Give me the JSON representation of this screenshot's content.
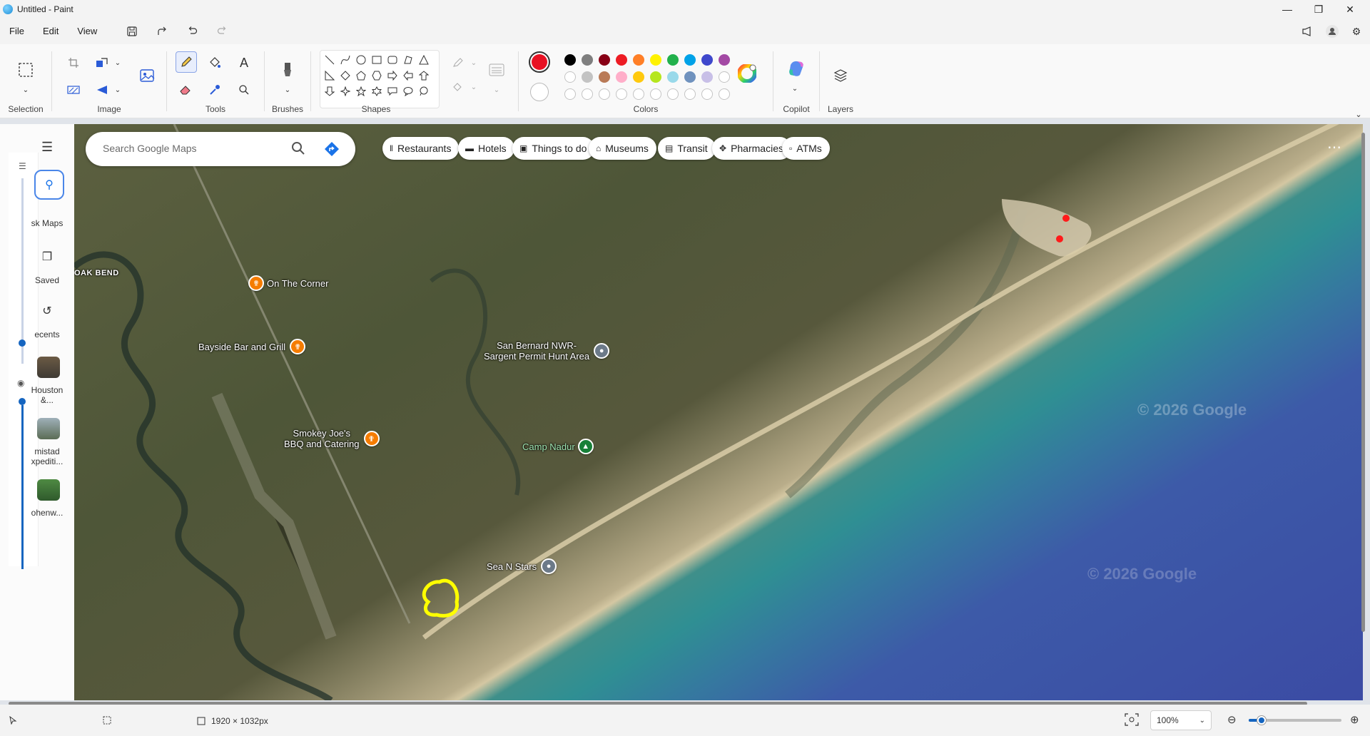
{
  "window": {
    "title": "Untitled - Paint"
  },
  "menu": {
    "file": "File",
    "edit": "Edit",
    "view": "View"
  },
  "ribbon": {
    "groups": {
      "selection": "Selection",
      "image": "Image",
      "tools": "Tools",
      "brushes": "Brushes",
      "shapes": "Shapes",
      "colors": "Colors",
      "copilot": "Copilot",
      "layers": "Layers"
    },
    "active_color": "#e81123",
    "palette_row1": [
      "#000000",
      "#7f7f7f",
      "#880015",
      "#ed1c24",
      "#ff7f27",
      "#fff200",
      "#22b14c",
      "#00a2e8",
      "#3f48cc",
      "#a349a4"
    ],
    "palette_row2": [
      "",
      "#c3c3c3",
      "#b97a57",
      "#ffaec9",
      "#ffc90e",
      "#b5e61d",
      "#99d9ea",
      "#7092be",
      "#c8bfe7"
    ]
  },
  "map": {
    "search_placeholder": "Search Google Maps",
    "chips": [
      {
        "label": "Restaurants",
        "icon": "fork-knife-icon"
      },
      {
        "label": "Hotels",
        "icon": "bed-icon"
      },
      {
        "label": "Things to do",
        "icon": "camera-icon"
      },
      {
        "label": "Museums",
        "icon": "museum-icon"
      },
      {
        "label": "Transit",
        "icon": "train-icon"
      },
      {
        "label": "Pharmacies",
        "icon": "pharmacy-icon"
      },
      {
        "label": "ATMs",
        "icon": "atm-icon"
      }
    ],
    "side_panel": {
      "ask_maps": "sk Maps",
      "saved": "Saved",
      "recents": "ecents",
      "recent1_line1": "Houston",
      "recent1_line2": "&...",
      "recent2_line1": "mistad",
      "recent2_line2": "xpediti...",
      "recent3_line1": "ohenw..."
    },
    "places": {
      "oak_bend": "OAK BEND",
      "on_the_corner": "On The Corner",
      "bayside": "Bayside Bar and Grill",
      "san_bernard_1": "San Bernard NWR-",
      "san_bernard_2": "Sargent Permit Hunt Area",
      "smokey_1": "Smokey Joe's",
      "smokey_2": "BBQ and Catering",
      "camp_nadur": "Camp Nadur",
      "sea_n_stars": "Sea N Stars"
    },
    "watermark": "© 2026 Google"
  },
  "status": {
    "dimensions": "1920 × 1032px",
    "zoom": "100%"
  }
}
